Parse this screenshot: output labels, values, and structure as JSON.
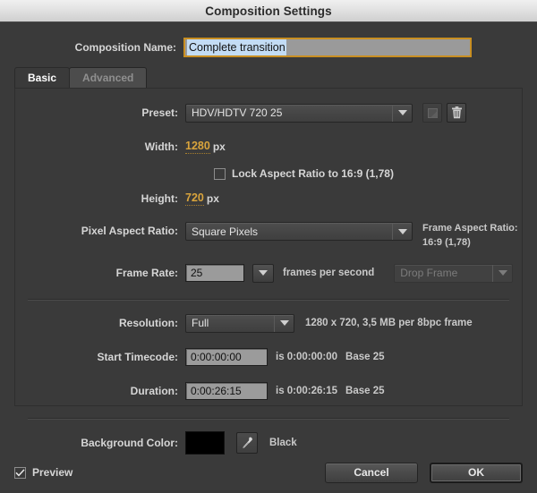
{
  "window": {
    "title": "Composition Settings"
  },
  "composition_name": {
    "label": "Composition Name:",
    "value": "Complete transition"
  },
  "tabs": [
    {
      "label": "Basic",
      "active": true
    },
    {
      "label": "Advanced",
      "active": false
    }
  ],
  "preset": {
    "label": "Preset:",
    "value": "HDV/HDTV 720 25",
    "save_icon": "save-preset-icon",
    "delete_icon": "trash-icon"
  },
  "width": {
    "label": "Width:",
    "value": "1280",
    "unit": "px"
  },
  "height": {
    "label": "Height:",
    "value": "720",
    "unit": "px"
  },
  "lock_aspect": {
    "label": "Lock Aspect Ratio to 16:9 (1,78)",
    "checked": false
  },
  "pixel_aspect_ratio": {
    "label": "Pixel Aspect Ratio:",
    "value": "Square Pixels"
  },
  "frame_aspect_ratio": {
    "label": "Frame Aspect Ratio:",
    "value": "16:9 (1,78)"
  },
  "frame_rate": {
    "label": "Frame Rate:",
    "value": "25",
    "suffix": "frames per second",
    "drop_frame": "Drop Frame"
  },
  "resolution": {
    "label": "Resolution:",
    "value": "Full",
    "info": "1280 x 720, 3,5 MB per 8bpc frame"
  },
  "start_timecode": {
    "label": "Start Timecode:",
    "value": "0:00:00:00",
    "info": "is 0:00:00:00",
    "base": "Base 25"
  },
  "duration": {
    "label": "Duration:",
    "value": "0:00:26:15",
    "info": "is 0:00:26:15",
    "base": "Base 25"
  },
  "background_color": {
    "label": "Background Color:",
    "swatch": "#000000",
    "eyedropper_icon": "eyedropper-icon",
    "name": "Black"
  },
  "footer": {
    "preview_label": "Preview",
    "preview_checked": true,
    "cancel_label": "Cancel",
    "ok_label": "OK"
  },
  "colors": {
    "dialog_bg": "#3a3a3a",
    "focus_border": "#c98f22",
    "hot_text": "#d9a43c",
    "selection": "#c3dcf4"
  }
}
